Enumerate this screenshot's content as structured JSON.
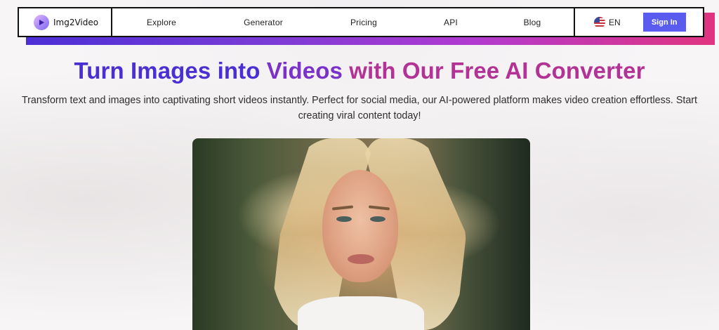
{
  "brand": {
    "name": "Img2Video"
  },
  "nav": {
    "items": [
      "Explore",
      "Generator",
      "Pricing",
      "API",
      "Blog"
    ],
    "language": "EN",
    "signin_label": "Sign In"
  },
  "hero": {
    "title_part1": "Turn Images into ",
    "title_part2": "Videos ",
    "title_part3": "with Our Free AI Converter",
    "subtitle": "Transform text and images into captivating short videos instantly. Perfect for social media, our AI-powered platform makes video creation effortless. Start creating viral content today!"
  },
  "colors": {
    "accent_button": "#5a5cf0",
    "title_blue": "#4a2fd2",
    "title_purple": "#7a32c8",
    "title_magenta": "#b23395"
  }
}
